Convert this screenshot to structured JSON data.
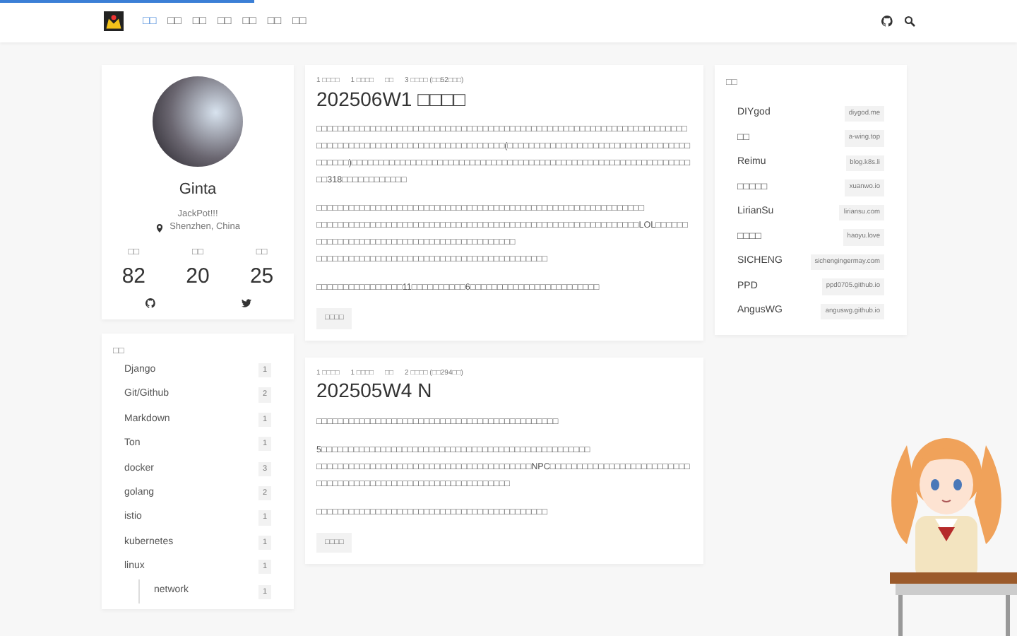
{
  "loading_bar": {
    "level": 0.25
  },
  "nav": {
    "links": [
      {
        "label": "□□",
        "selected": true
      },
      {
        "label": "□□",
        "selected": false
      },
      {
        "label": "□□",
        "selected": false
      },
      {
        "label": "□□",
        "selected": false
      },
      {
        "label": "□□",
        "selected": false
      },
      {
        "label": "□□",
        "selected": false
      },
      {
        "label": "□□",
        "selected": false
      }
    ]
  },
  "profile": {
    "name": "Ginta",
    "bio": "JackPot!!!",
    "location": "Shenzhen, China",
    "stats": [
      {
        "label": "□□",
        "value": "82"
      },
      {
        "label": "□□",
        "value": "20"
      },
      {
        "label": "□□",
        "value": "25"
      }
    ]
  },
  "categories": {
    "title": "□□",
    "items": [
      {
        "name": "Django",
        "count": "1"
      },
      {
        "name": "Git/Github",
        "count": "2"
      },
      {
        "name": "Markdown",
        "count": "1"
      },
      {
        "name": "Ton",
        "count": "1"
      },
      {
        "name": "docker",
        "count": "3"
      },
      {
        "name": "golang",
        "count": "2"
      },
      {
        "name": "istio",
        "count": "1"
      },
      {
        "name": "kubernetes",
        "count": "1"
      },
      {
        "name": "linux",
        "count": "1",
        "children": [
          {
            "name": "network",
            "count": "1"
          }
        ]
      }
    ]
  },
  "posts": [
    {
      "meta": [
        "1 □□□□",
        "1 □□□□",
        "□□",
        "3 □□□□ (□□52□□□)"
      ],
      "title": "202506W1 □□□□",
      "paragraphs": [
        [
          "□□□□□□□□□□□□□□□□□□□□□□□□□□□□□□□□□□□□□□□□□□□□□□□□□□□□□□□□□□□□□□□□□□□□□□□□□□□□□□□□□□□□□□□□□□□□□□□□□□□□□□□□(□□□□□□□□□□□□□□□□□□□□□□□□□□□□□□□□□□□□□□□□)□□□□□□□□□□□□□□□□□□□□□□□□□□□□□□□□□□□□□□□□□□□□□□□□□□□□□□□□□□□□□□□□□318□□□□□□□□□□□□"
        ],
        [
          "□□□□□□□□□□□□□□□□□□□□□□□□□□□□□□□□□□□□□□□□□□□□□□□□□□□□□□□□□□□□□",
          "□□□□□□□□□□□□□□□□□□□□□□□□□□□□□□□□□□□□□□□□□□□□□□□□□□□□□□□□□□□□LOL□□□□□□□□□□□□□□□□□□□□□□□□□□□□□□□□□□□□□□□□□□□",
          "□□□□□□□□□□□□□□□□□□□□□□□□□□□□□□□□□□□□□□□□□□□"
        ],
        [
          "□□□□□□□□□□□□□□□□11□□□□□□□□□□6□□□□□□□□□□□□□□□□□□□□□□□□"
        ]
      ],
      "button": "□□□□"
    },
    {
      "meta": [
        "1 □□□□",
        "1 □□□□",
        "□□",
        "2 □□□□ (□□294□□)"
      ],
      "title": "202505W4 N",
      "paragraphs": [
        [
          "□□□□□□□□□□□□□□□□□□□□□□□□□□□□□□□□□□□□□□□□□□□□□"
        ],
        [
          "5□□□□□□□□□□□□□□□□□□□□□□□□□□□□□□□□□□□□□□□□□□□□□□□□□□",
          "□□□□□□□□□□□□□□□□□□□□□□□□□□□□□□□□□□□□□□□□NPC□□□□□□□□□□□□□□□□□□□□□□□□□□□□□□□□□□□□□□□□□□□□□□□□□□□□□□□□□□□□□□"
        ],
        [
          "□□□□□□□□□□□□□□□□□□□□□□□□□□□□□□□□□□□□□□□□□□□"
        ]
      ],
      "button": "□□□□"
    }
  ],
  "friends": {
    "title": "□□",
    "items": [
      {
        "name": "DIYgod",
        "url": "diygod.me"
      },
      {
        "name": "□□",
        "url": "a-wing.top"
      },
      {
        "name": "Reimu",
        "url": "blog.k8s.li"
      },
      {
        "name": "□□□□□",
        "url": "xuanwo.io"
      },
      {
        "name": "LirianSu",
        "url": "liriansu.com"
      },
      {
        "name": "□□□□",
        "url": "haoyu.love"
      },
      {
        "name": "SICHENG",
        "url": "sichengingermay.com"
      },
      {
        "name": "PPD",
        "url": "ppd0705.github.io"
      },
      {
        "name": "AngusWG",
        "url": "anguswg.github.io"
      }
    ]
  }
}
